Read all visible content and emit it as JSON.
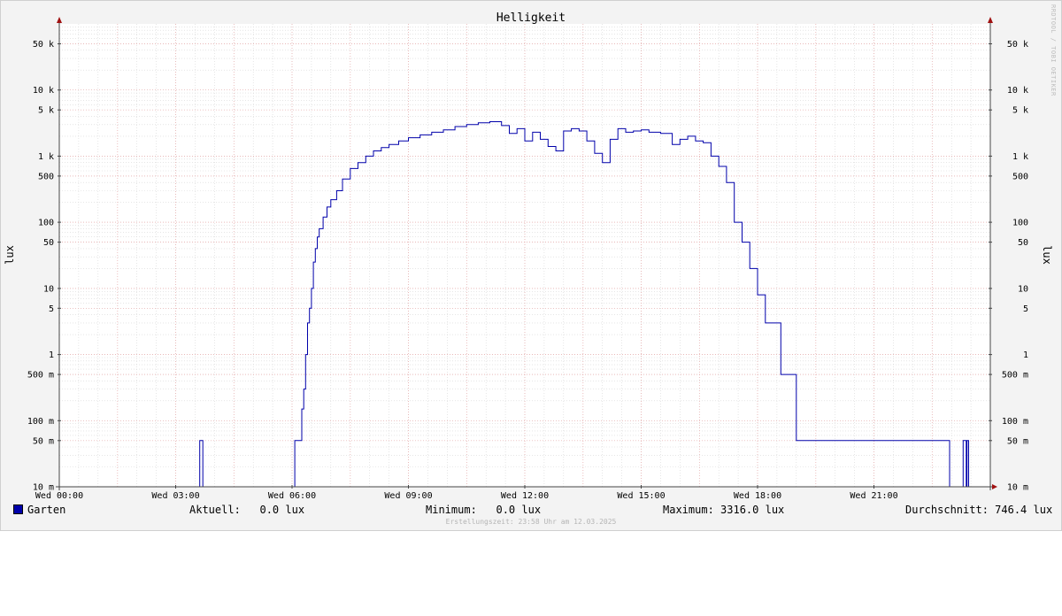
{
  "chart_data": {
    "type": "line",
    "title": "Helligkeit",
    "ylabel": "lux",
    "y_scale": "log",
    "ylim": [
      0.01,
      100000
    ],
    "xlim_hours": [
      0,
      24
    ],
    "y_ticks": [
      {
        "value": 0.01,
        "label": "10 m"
      },
      {
        "value": 0.05,
        "label": "50 m"
      },
      {
        "value": 0.1,
        "label": "100 m"
      },
      {
        "value": 0.5,
        "label": "500 m"
      },
      {
        "value": 1,
        "label": "1"
      },
      {
        "value": 5,
        "label": "5"
      },
      {
        "value": 10,
        "label": "10"
      },
      {
        "value": 50,
        "label": "50"
      },
      {
        "value": 100,
        "label": "100"
      },
      {
        "value": 500,
        "label": "500"
      },
      {
        "value": 1000,
        "label": "1 k"
      },
      {
        "value": 5000,
        "label": "5 k"
      },
      {
        "value": 10000,
        "label": "10 k"
      },
      {
        "value": 50000,
        "label": "50 k"
      }
    ],
    "x_ticks": [
      {
        "hour": 0,
        "label": "Wed 00:00"
      },
      {
        "hour": 3,
        "label": "Wed 03:00"
      },
      {
        "hour": 6,
        "label": "Wed 06:00"
      },
      {
        "hour": 9,
        "label": "Wed 09:00"
      },
      {
        "hour": 12,
        "label": "Wed 12:00"
      },
      {
        "hour": 15,
        "label": "Wed 15:00"
      },
      {
        "hour": 18,
        "label": "Wed 18:00"
      },
      {
        "hour": 21,
        "label": "Wed 21:00"
      }
    ],
    "grid": true,
    "line_color": "#0000aa",
    "grid_minor_color": "#d6d6d6",
    "grid_major_color": "#e7a8a8",
    "series": [
      {
        "name": "Garten",
        "x_hours": [
          0,
          3.6,
          3.62,
          3.68,
          3.7,
          6.05,
          6.07,
          6.2,
          6.25,
          6.3,
          6.35,
          6.4,
          6.45,
          6.5,
          6.55,
          6.6,
          6.65,
          6.7,
          6.8,
          6.9,
          7.0,
          7.15,
          7.3,
          7.5,
          7.7,
          7.9,
          8.1,
          8.3,
          8.5,
          8.75,
          9.0,
          9.3,
          9.6,
          9.9,
          10.2,
          10.5,
          10.8,
          11.1,
          11.4,
          11.6,
          11.8,
          12.0,
          12.2,
          12.4,
          12.6,
          12.8,
          13.0,
          13.2,
          13.4,
          13.6,
          13.8,
          14.0,
          14.2,
          14.4,
          14.6,
          14.8,
          15.0,
          15.2,
          15.5,
          15.8,
          16.0,
          16.2,
          16.4,
          16.6,
          16.8,
          17.0,
          17.2,
          17.4,
          17.6,
          17.8,
          18.0,
          18.2,
          18.4,
          18.6,
          18.8,
          19.0,
          19.1,
          19.4,
          19.45,
          19.6,
          20.5,
          21.0,
          22.0,
          22.9,
          22.95,
          23.3,
          23.35,
          23.38,
          23.4,
          23.42,
          23.44,
          23.46,
          24.0
        ],
        "values": [
          0.01,
          0.01,
          0.05,
          0.05,
          0.01,
          0.01,
          0.05,
          0.05,
          0.15,
          0.3,
          1,
          3,
          5,
          10,
          25,
          40,
          60,
          80,
          120,
          170,
          220,
          300,
          450,
          650,
          800,
          1000,
          1200,
          1350,
          1500,
          1700,
          1900,
          2100,
          2300,
          2500,
          2800,
          3000,
          3200,
          3316,
          2900,
          2200,
          2600,
          1700,
          2300,
          1800,
          1400,
          1200,
          2400,
          2600,
          2400,
          1700,
          1100,
          800,
          1800,
          2600,
          2300,
          2400,
          2500,
          2300,
          2200,
          1500,
          1800,
          2000,
          1700,
          1600,
          1000,
          700,
          400,
          100,
          50,
          20,
          8,
          3,
          3,
          0.5,
          0.5,
          0.05,
          0.05,
          0.05,
          0.05,
          0.05,
          0.05,
          0.05,
          0.05,
          0.05,
          0.01,
          0.05,
          0.05,
          0.01,
          0.05,
          0.05,
          0.01,
          0.01,
          0.01
        ]
      }
    ]
  },
  "legend": {
    "series_name": "Garten",
    "swatch_color": "#0000aa",
    "current_label": "Aktuell:",
    "current_value": "0.0 lux",
    "min_label": "Minimum:",
    "min_value": "0.0 lux",
    "max_label": "Maximum:",
    "max_value": "3316.0 lux",
    "avg_label": "Durchschnitt:",
    "avg_value": "746.4 lux"
  },
  "watermark": "RRDTOOL / TOBI OETIKER",
  "footer": "Erstellungszeit: 23:58 Uhr am 12.03.2025"
}
